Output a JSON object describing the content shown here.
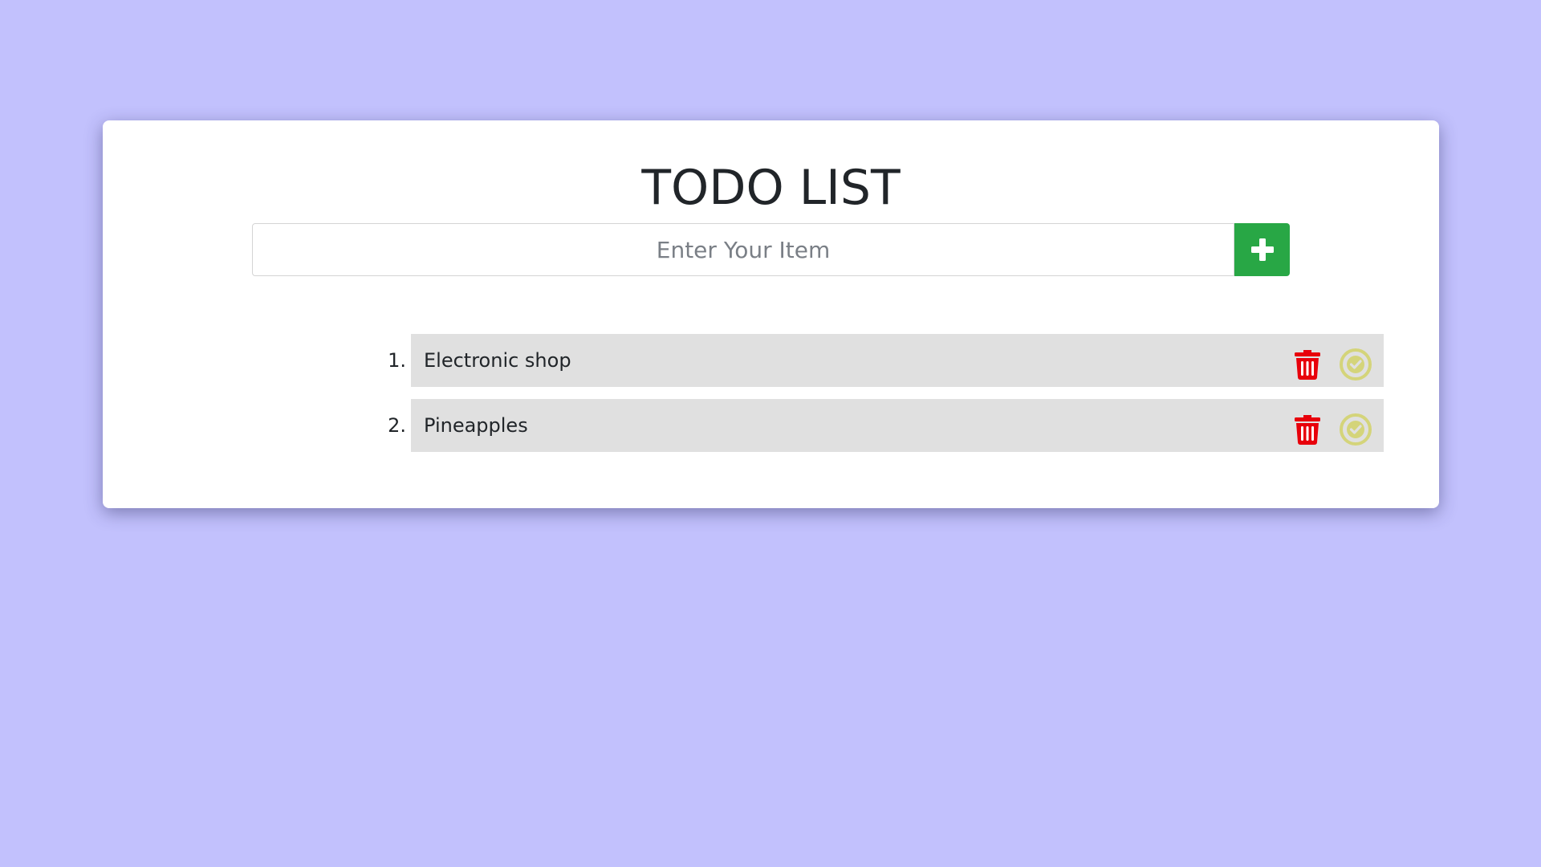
{
  "title": "TODO LIST",
  "input": {
    "placeholder": "Enter Your Item",
    "value": ""
  },
  "add_button": {
    "icon": "plus-icon",
    "color": "#28a745"
  },
  "items": [
    {
      "number": "1.",
      "text": "Electronic shop"
    },
    {
      "number": "2.",
      "text": "Pineapples"
    }
  ],
  "icons": {
    "delete": "trash-icon",
    "complete": "check-circle-icon"
  },
  "colors": {
    "background": "#c2c1fd",
    "card": "#ffffff",
    "item_bar": "#e0e0e0",
    "delete": "#e8000b",
    "complete": "#d4d47a"
  }
}
